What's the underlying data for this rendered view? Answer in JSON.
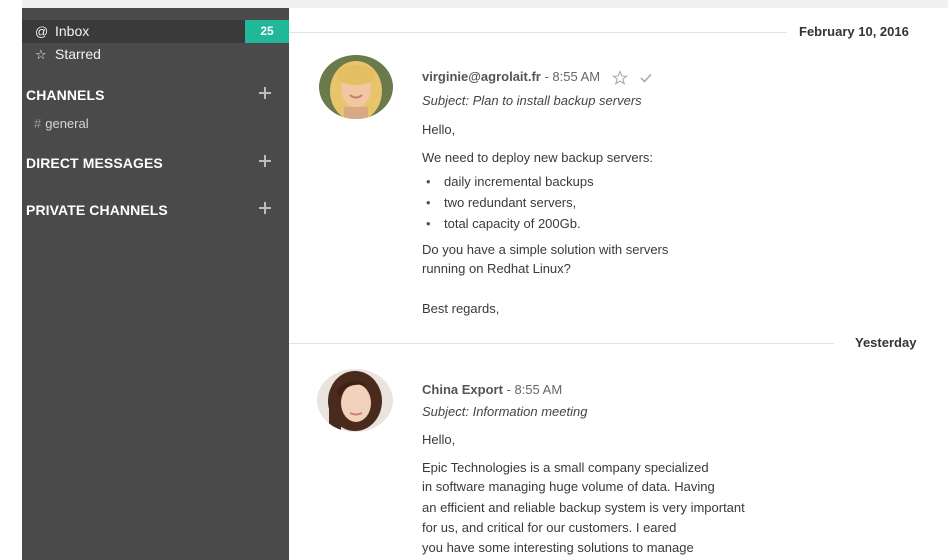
{
  "sidebar": {
    "inbox": {
      "icon": "@",
      "label": "Inbox",
      "count": "25"
    },
    "starred": {
      "icon": "☆",
      "label": "Starred"
    },
    "sections": {
      "channels": "CHANNELS",
      "direct_messages": "DIRECT MESSAGES",
      "private_channels": "PRIVATE CHANNELS"
    },
    "channels": [
      {
        "hash": "#",
        "name": "general"
      }
    ]
  },
  "thread": {
    "dates": {
      "first": "February 10, 2016",
      "second": "Yesterday"
    },
    "messages": [
      {
        "author": "virginie@agrolait.fr",
        "time": " - 8:55 AM",
        "subject": "Subject: Plan to install backup servers",
        "greeting": "Hello,",
        "intro": "We need to deploy new backup servers:",
        "bullets": [
          "daily incremental backups",
          "two redundant servers,",
          "total capacity of 200Gb."
        ],
        "question_1": "Do you have a simple solution with servers",
        "question_2": "running on Redhat Linux?",
        "closing": "Best regards,"
      },
      {
        "author": "China Export",
        "time": " - 8:55 AM",
        "subject": "Subject: Information meeting",
        "greeting": "Hello,",
        "lines": [
          "Epic Technologies is a small company specialized",
          "in software managing huge volume of data. Having",
          "an efficient and reliable backup system is very important",
          "for us, and critical for our customers. I eared",
          "you have some interesting solutions to manage"
        ]
      }
    ]
  },
  "colors": {
    "sidebar_bg": "#4a4a4a",
    "badge_bg": "#21b799",
    "active_bg": "#3a3a3a"
  },
  "icons": [
    "at-icon",
    "star-outline-icon",
    "hash-icon",
    "plus-icon",
    "check-icon"
  ]
}
